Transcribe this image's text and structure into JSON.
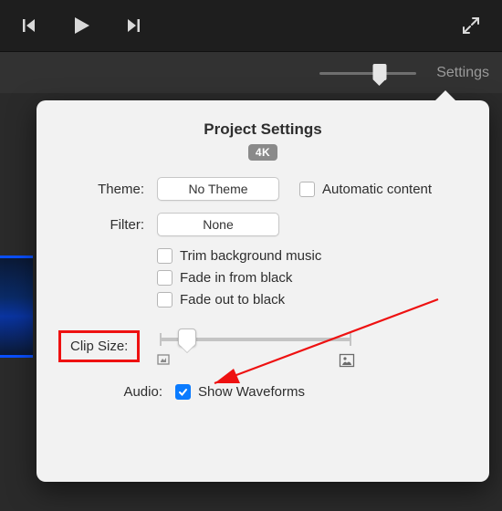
{
  "settingsButton": {
    "label": "Settings"
  },
  "popover": {
    "title": "Project Settings",
    "badge": "4K",
    "theme": {
      "label": "Theme:",
      "value": "No Theme"
    },
    "automaticContent": {
      "label": "Automatic content",
      "checked": false
    },
    "filter": {
      "label": "Filter:",
      "value": "None"
    },
    "options": {
      "trim": {
        "label": "Trim background music",
        "checked": false
      },
      "fadeIn": {
        "label": "Fade in from black",
        "checked": false
      },
      "fadeOut": {
        "label": "Fade out to black",
        "checked": false
      }
    },
    "clipSize": {
      "label": "Clip Size:"
    },
    "audio": {
      "label": "Audio:",
      "showWaveforms": {
        "label": "Show Waveforms",
        "checked": true
      }
    }
  },
  "annotation": {
    "highlight": "clip-size-label"
  }
}
